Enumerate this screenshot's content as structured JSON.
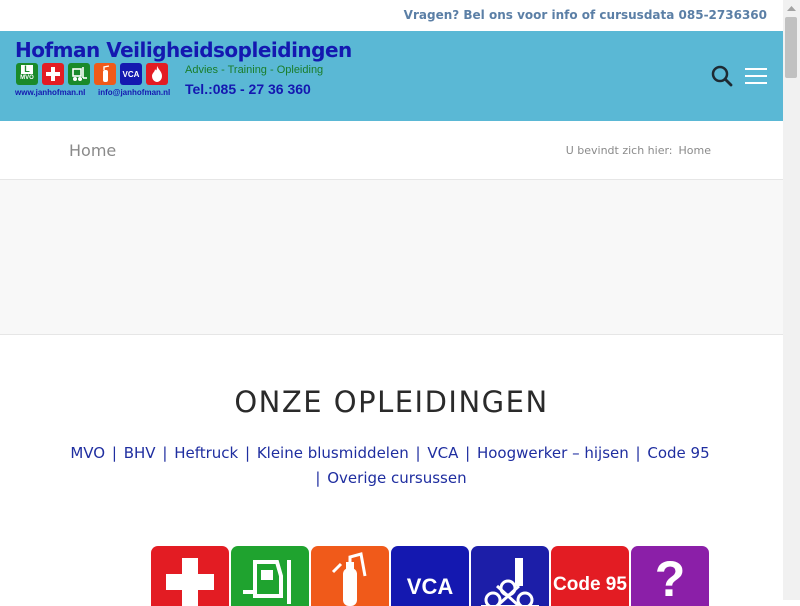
{
  "topbar": {
    "contact_text": "Vragen? Bel ons voor info of cursusdata 085-2736360"
  },
  "logo": {
    "title": "Hofman Veiligheidsopleidingen",
    "tagline": "Advies - Training - Opleiding",
    "phone": "Tel.:085 - 27 36 360",
    "website": "www.janhofman.nl",
    "email": "info@janhofman.nl",
    "badges": [
      {
        "icon": "l-plate-mvo-icon",
        "label": "MVO",
        "color": "#1a8a2a"
      },
      {
        "icon": "first-aid-cross-icon",
        "label": "",
        "color": "#e31c23"
      },
      {
        "icon": "forklift-icon",
        "label": "",
        "color": "#1a8a2a"
      },
      {
        "icon": "fire-extinguisher-icon",
        "label": "",
        "color": "#f05a1a"
      },
      {
        "icon": "vca-icon",
        "label": "VCA",
        "color": "#1418b0"
      },
      {
        "icon": "flame-icon",
        "label": "",
        "color": "#e31c23"
      }
    ]
  },
  "header": {
    "search_icon": "search-icon",
    "menu_icon": "hamburger-menu-icon"
  },
  "titlebar": {
    "page_title": "Home",
    "breadcrumb_prefix": "U bevindt zich hier:",
    "breadcrumb_current": "Home"
  },
  "main": {
    "heading": "ONZE OPLEIDINGEN",
    "courses": [
      "MVO",
      "BHV",
      "Heftruck",
      "Kleine blusmiddelen",
      "VCA",
      "Hoogwerker – hijsen",
      "Code 95",
      "Overige cursussen"
    ],
    "separator": "|",
    "tiles": [
      {
        "name": "bhv-tile",
        "icon": "first-aid-cross-icon",
        "label": "",
        "color": "#e31c23"
      },
      {
        "name": "heftruck-tile",
        "icon": "forklift-icon",
        "label": "",
        "color": "#1fa32f"
      },
      {
        "name": "blusmiddelen-tile",
        "icon": "fire-extinguisher-icon",
        "label": "",
        "color": "#f05a1a"
      },
      {
        "name": "vca-tile",
        "icon": "vca-icon",
        "label": "VCA",
        "color": "#1418b0"
      },
      {
        "name": "hoogwerker-tile",
        "icon": "aerial-lift-icon",
        "label": "",
        "color": "#1c1ea8"
      },
      {
        "name": "code95-tile",
        "icon": "code95-icon",
        "label": "Code 95",
        "color": "#e31c23"
      },
      {
        "name": "overige-tile",
        "icon": "question-mark-icon",
        "label": "?",
        "color": "#8b1fa8"
      }
    ]
  }
}
